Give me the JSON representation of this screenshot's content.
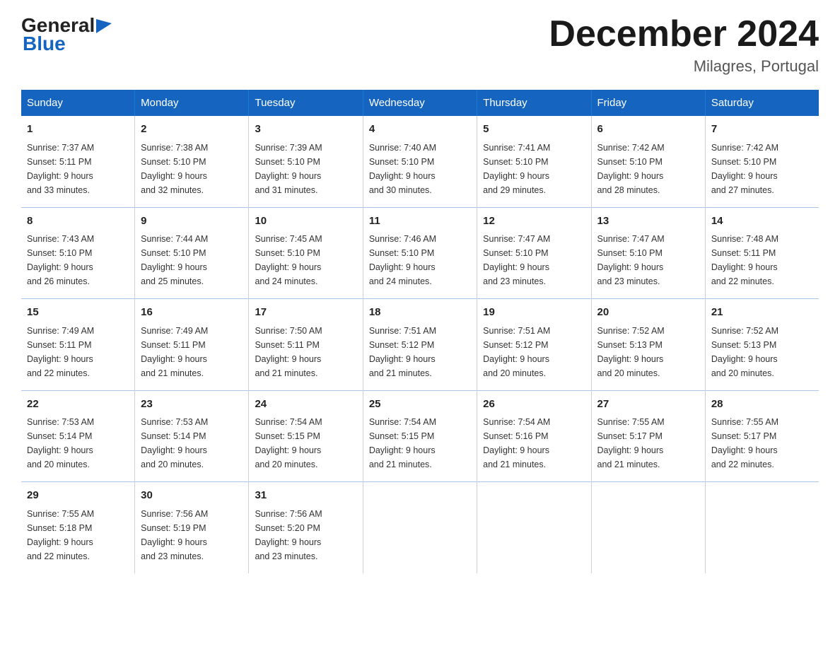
{
  "header": {
    "logo_line1": "General",
    "logo_line2": "Blue",
    "title": "December 2024",
    "subtitle": "Milagres, Portugal"
  },
  "days_of_week": [
    "Sunday",
    "Monday",
    "Tuesday",
    "Wednesday",
    "Thursday",
    "Friday",
    "Saturday"
  ],
  "weeks": [
    [
      {
        "day": "1",
        "sunrise": "7:37 AM",
        "sunset": "5:11 PM",
        "daylight": "9 hours and 33 minutes."
      },
      {
        "day": "2",
        "sunrise": "7:38 AM",
        "sunset": "5:10 PM",
        "daylight": "9 hours and 32 minutes."
      },
      {
        "day": "3",
        "sunrise": "7:39 AM",
        "sunset": "5:10 PM",
        "daylight": "9 hours and 31 minutes."
      },
      {
        "day": "4",
        "sunrise": "7:40 AM",
        "sunset": "5:10 PM",
        "daylight": "9 hours and 30 minutes."
      },
      {
        "day": "5",
        "sunrise": "7:41 AM",
        "sunset": "5:10 PM",
        "daylight": "9 hours and 29 minutes."
      },
      {
        "day": "6",
        "sunrise": "7:42 AM",
        "sunset": "5:10 PM",
        "daylight": "9 hours and 28 minutes."
      },
      {
        "day": "7",
        "sunrise": "7:42 AM",
        "sunset": "5:10 PM",
        "daylight": "9 hours and 27 minutes."
      }
    ],
    [
      {
        "day": "8",
        "sunrise": "7:43 AM",
        "sunset": "5:10 PM",
        "daylight": "9 hours and 26 minutes."
      },
      {
        "day": "9",
        "sunrise": "7:44 AM",
        "sunset": "5:10 PM",
        "daylight": "9 hours and 25 minutes."
      },
      {
        "day": "10",
        "sunrise": "7:45 AM",
        "sunset": "5:10 PM",
        "daylight": "9 hours and 24 minutes."
      },
      {
        "day": "11",
        "sunrise": "7:46 AM",
        "sunset": "5:10 PM",
        "daylight": "9 hours and 24 minutes."
      },
      {
        "day": "12",
        "sunrise": "7:47 AM",
        "sunset": "5:10 PM",
        "daylight": "9 hours and 23 minutes."
      },
      {
        "day": "13",
        "sunrise": "7:47 AM",
        "sunset": "5:10 PM",
        "daylight": "9 hours and 23 minutes."
      },
      {
        "day": "14",
        "sunrise": "7:48 AM",
        "sunset": "5:11 PM",
        "daylight": "9 hours and 22 minutes."
      }
    ],
    [
      {
        "day": "15",
        "sunrise": "7:49 AM",
        "sunset": "5:11 PM",
        "daylight": "9 hours and 22 minutes."
      },
      {
        "day": "16",
        "sunrise": "7:49 AM",
        "sunset": "5:11 PM",
        "daylight": "9 hours and 21 minutes."
      },
      {
        "day": "17",
        "sunrise": "7:50 AM",
        "sunset": "5:11 PM",
        "daylight": "9 hours and 21 minutes."
      },
      {
        "day": "18",
        "sunrise": "7:51 AM",
        "sunset": "5:12 PM",
        "daylight": "9 hours and 21 minutes."
      },
      {
        "day": "19",
        "sunrise": "7:51 AM",
        "sunset": "5:12 PM",
        "daylight": "9 hours and 20 minutes."
      },
      {
        "day": "20",
        "sunrise": "7:52 AM",
        "sunset": "5:13 PM",
        "daylight": "9 hours and 20 minutes."
      },
      {
        "day": "21",
        "sunrise": "7:52 AM",
        "sunset": "5:13 PM",
        "daylight": "9 hours and 20 minutes."
      }
    ],
    [
      {
        "day": "22",
        "sunrise": "7:53 AM",
        "sunset": "5:14 PM",
        "daylight": "9 hours and 20 minutes."
      },
      {
        "day": "23",
        "sunrise": "7:53 AM",
        "sunset": "5:14 PM",
        "daylight": "9 hours and 20 minutes."
      },
      {
        "day": "24",
        "sunrise": "7:54 AM",
        "sunset": "5:15 PM",
        "daylight": "9 hours and 20 minutes."
      },
      {
        "day": "25",
        "sunrise": "7:54 AM",
        "sunset": "5:15 PM",
        "daylight": "9 hours and 21 minutes."
      },
      {
        "day": "26",
        "sunrise": "7:54 AM",
        "sunset": "5:16 PM",
        "daylight": "9 hours and 21 minutes."
      },
      {
        "day": "27",
        "sunrise": "7:55 AM",
        "sunset": "5:17 PM",
        "daylight": "9 hours and 21 minutes."
      },
      {
        "day": "28",
        "sunrise": "7:55 AM",
        "sunset": "5:17 PM",
        "daylight": "9 hours and 22 minutes."
      }
    ],
    [
      {
        "day": "29",
        "sunrise": "7:55 AM",
        "sunset": "5:18 PM",
        "daylight": "9 hours and 22 minutes."
      },
      {
        "day": "30",
        "sunrise": "7:56 AM",
        "sunset": "5:19 PM",
        "daylight": "9 hours and 23 minutes."
      },
      {
        "day": "31",
        "sunrise": "7:56 AM",
        "sunset": "5:20 PM",
        "daylight": "9 hours and 23 minutes."
      },
      null,
      null,
      null,
      null
    ]
  ],
  "labels": {
    "sunrise": "Sunrise:",
    "sunset": "Sunset:",
    "daylight": "Daylight:"
  }
}
